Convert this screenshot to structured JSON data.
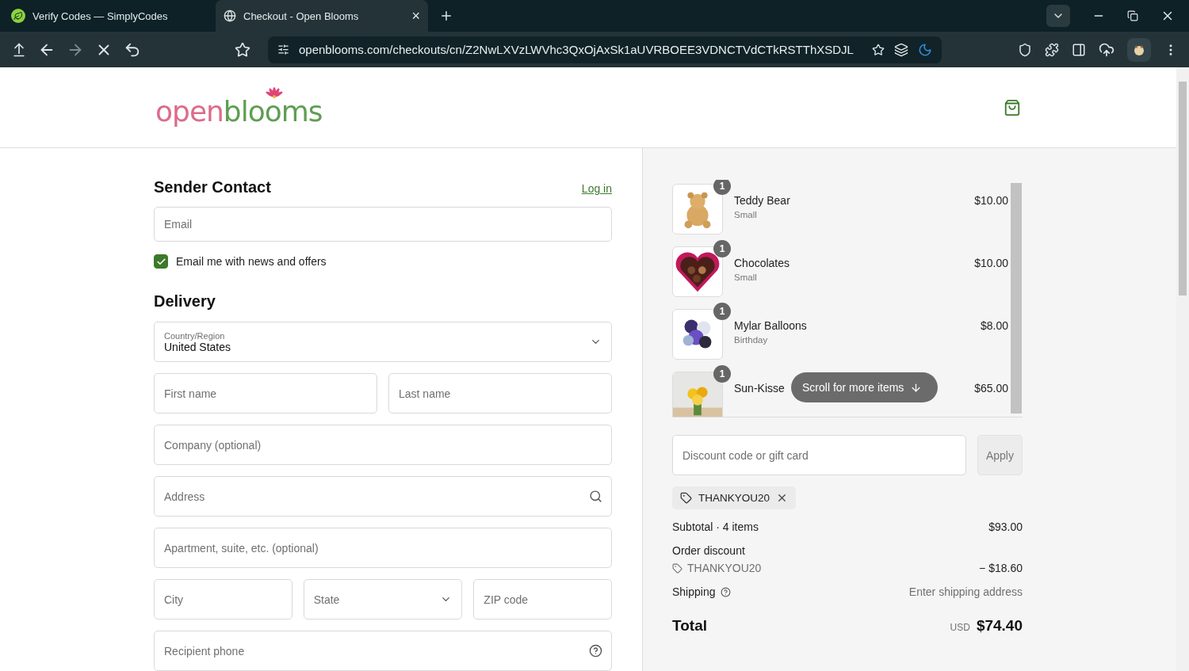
{
  "browser": {
    "tabs": [
      {
        "title": "Verify Codes — SimplyCodes",
        "selected": false
      },
      {
        "title": "Checkout - Open Blooms",
        "selected": true
      }
    ],
    "close_tab": "×",
    "url": "openblooms.com/checkouts/cn/Z2NwLXVzLWVhc3QxOjAxSk1aUVRBOEE3VDNCTVdCTkRSTThXSDJL"
  },
  "logo": {
    "part_1": "open",
    "part_2": "blooms"
  },
  "sender_contact": {
    "heading": "Sender Contact",
    "login_link": "Log in",
    "email": {
      "placeholder": "Email"
    },
    "newsletter": {
      "label": "Email me with news and offers",
      "checked": true
    }
  },
  "delivery": {
    "heading": "Delivery",
    "rows": [
      [
        {
          "kind": "select",
          "label": "Country/Region",
          "value": "United States"
        }
      ],
      [
        {
          "kind": "text",
          "placeholder": "First name"
        },
        {
          "kind": "text",
          "placeholder": "Last name"
        }
      ],
      [
        {
          "kind": "text",
          "placeholder": "Company (optional)"
        }
      ],
      [
        {
          "kind": "search",
          "placeholder": "Address"
        }
      ],
      [
        {
          "kind": "text",
          "placeholder": "Apartment, suite, etc. (optional)"
        }
      ],
      [
        {
          "kind": "text",
          "placeholder": "City"
        },
        {
          "kind": "select",
          "placeholder": "State"
        },
        {
          "kind": "text",
          "placeholder": "ZIP code"
        }
      ],
      [
        {
          "kind": "help",
          "placeholder": "Recipient phone"
        }
      ]
    ]
  },
  "cart": {
    "items": [
      {
        "name": "Teddy Bear",
        "variant": "Small",
        "price": "$10.00",
        "quantity": "1"
      },
      {
        "name": "Chocolates",
        "variant": "Small",
        "price": "$10.00",
        "quantity": "1"
      },
      {
        "name": "Mylar Balloons",
        "variant": "Birthday",
        "price": "$8.00",
        "quantity": "1"
      },
      {
        "name": "Sun-Kisse",
        "price": "$65.00",
        "quantity": "1"
      }
    ],
    "scroll_hint": "Scroll for more items",
    "discount": {
      "placeholder": "Discount code or gift card",
      "button": "Apply"
    },
    "applied_code": "THANKYOU20",
    "subtotal": {
      "label": "Subtotal · 4 items",
      "value": "$93.00"
    },
    "order_discount": {
      "label": "Order discount",
      "code": "THANKYOU20",
      "value": "− $18.60"
    },
    "shipping": {
      "label": "Shipping",
      "value": "Enter shipping address"
    },
    "total": {
      "label": "Total",
      "currency": "USD",
      "value": "$74.40"
    }
  }
}
